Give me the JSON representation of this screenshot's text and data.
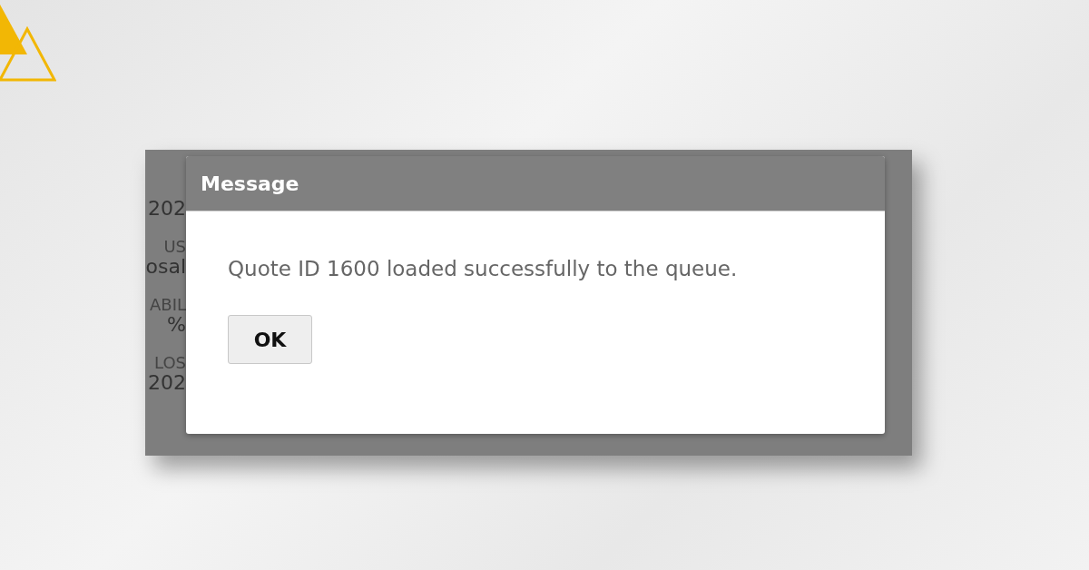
{
  "background_fields": [
    {
      "text": "202",
      "kind": "value"
    },
    {
      "text": "US",
      "kind": "label"
    },
    {
      "text": "osal",
      "kind": "value"
    },
    {
      "text": "ABIL",
      "kind": "label"
    },
    {
      "text": "%",
      "kind": "value"
    },
    {
      "text": "LOS",
      "kind": "label"
    },
    {
      "text": "202",
      "kind": "value"
    }
  ],
  "dialog": {
    "title": "Message",
    "message": "Quote ID 1600 loaded successfully to the queue.",
    "buttons": [
      "OK"
    ]
  }
}
